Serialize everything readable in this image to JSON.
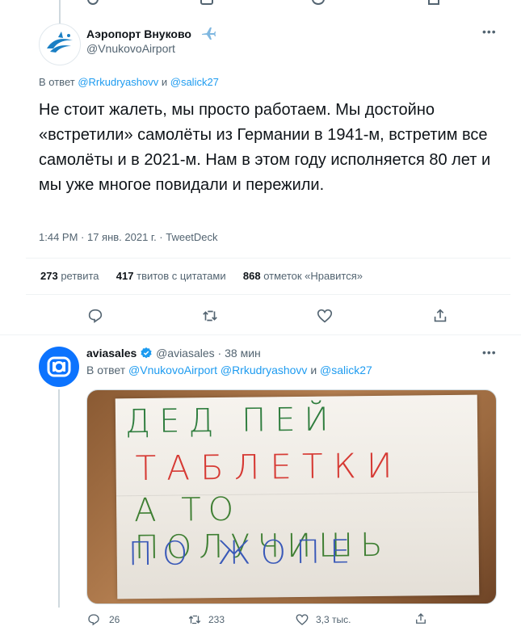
{
  "tweet1": {
    "author_name": "Аэропорт Внуково",
    "author_handle": "@VnukovoAirport",
    "reply_prefix": "В ответ",
    "reply_user1": "@Rrkudryashovv",
    "reply_and": "и",
    "reply_user2": "@salick27",
    "text": "Не стоит жалеть, мы просто работаем. Мы достойно «встретили» самолёты из Германии в 1941-м, встретим все самолёты и в 2021-м. Нам в этом году исполняется 80 лет и мы уже многое повидали и пережили.",
    "timestamp": "1:44 PM · 17 янв. 2021 г. · TweetDeck",
    "stats": {
      "retweets_num": "273",
      "retweets_label": "ретвита",
      "quotes_num": "417",
      "quotes_label": "твитов с цитатами",
      "likes_num": "868",
      "likes_label": "отметок «Нравится»"
    }
  },
  "tweet2": {
    "author_name": "aviasales",
    "author_handle": "@aviasales",
    "sep": "·",
    "time": "38 мин",
    "reply_prefix": "В ответ",
    "reply_user1": "@VnukovoAirport",
    "reply_user2": "@Rrkudryashovv",
    "reply_and": "и",
    "reply_user3": "@salick27",
    "image_text": {
      "line1": "ДЕД ПЕЙ",
      "line2": "ТАБЛЕТКИ",
      "line3": "А ТО ПОЛУЧИШЬ",
      "line4": "ПО ЖОПЕ"
    },
    "actions": {
      "reply_count": "26",
      "retweet_count": "233",
      "like_count": "3,3 тыс."
    }
  },
  "colors": {
    "accent": "#1d9bf0",
    "muted": "#536471",
    "border": "#eff3f4"
  }
}
